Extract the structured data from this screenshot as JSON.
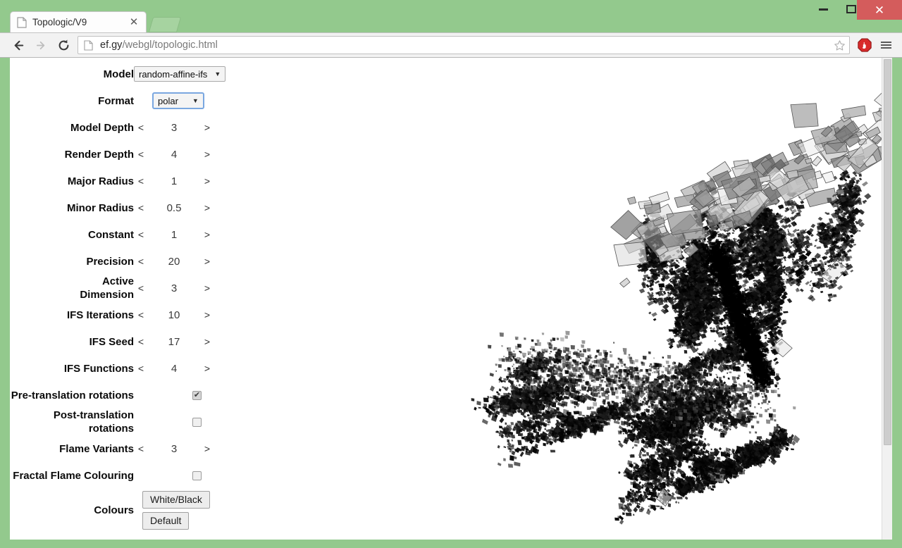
{
  "window": {
    "minimize_label": "–",
    "maximize_label": "□",
    "close_label": "✕"
  },
  "browser": {
    "tab": {
      "title": "Topologic/V9",
      "close_label": "✕",
      "favicon": "page-icon"
    },
    "new_tab_label": "",
    "toolbar": {
      "back_label": "←",
      "forward_label": "→",
      "reload_label": "⟳",
      "url_host": "ef.gy",
      "url_path": "/webgl/topologic.html",
      "url_full": "ef.gy/webgl/topologic.html",
      "bookmark_icon": "star-icon",
      "extension_icon": "adblock-icon",
      "menu_icon": "hamburger-icon"
    }
  },
  "settings": {
    "rows": [
      {
        "label": "Model",
        "type": "select",
        "value": "random-affine-ifs",
        "focused": false
      },
      {
        "label": "Format",
        "type": "select",
        "value": "polar",
        "focused": true
      },
      {
        "label": "Model Depth",
        "type": "stepper",
        "value": "3",
        "prev": "<",
        "next": ">"
      },
      {
        "label": "Render Depth",
        "type": "stepper",
        "value": "4",
        "prev": "<",
        "next": ">"
      },
      {
        "label": "Major Radius",
        "type": "stepper",
        "value": "1",
        "prev": "<",
        "next": ">"
      },
      {
        "label": "Minor Radius",
        "type": "stepper",
        "value": "0.5",
        "prev": "<",
        "next": ">"
      },
      {
        "label": "Constant",
        "type": "stepper",
        "value": "1",
        "prev": "<",
        "next": ">"
      },
      {
        "label": "Precision",
        "type": "stepper",
        "value": "20",
        "prev": "<",
        "next": ">"
      },
      {
        "label": "Active Dimension",
        "type": "stepper",
        "value": "3",
        "prev": "<",
        "next": ">"
      },
      {
        "label": "IFS Iterations",
        "type": "stepper",
        "value": "10",
        "prev": "<",
        "next": ">"
      },
      {
        "label": "IFS Seed",
        "type": "stepper",
        "value": "17",
        "prev": "<",
        "next": ">"
      },
      {
        "label": "IFS Functions",
        "type": "stepper",
        "value": "4",
        "prev": "<",
        "next": ">"
      },
      {
        "label": "Pre-translation rotations",
        "type": "checkbox",
        "checked": true,
        "tick": "✔"
      },
      {
        "label": "Post-translation rotations",
        "type": "checkbox",
        "checked": false,
        "tick": ""
      },
      {
        "label": "Flame Variants",
        "type": "stepper",
        "value": "3",
        "prev": "<",
        "next": ">"
      },
      {
        "label": "Fractal Flame Colouring",
        "type": "checkbox",
        "checked": false,
        "tick": ""
      },
      {
        "label": "Colours",
        "type": "buttons",
        "buttons": [
          "White/Black",
          "Default"
        ]
      }
    ]
  },
  "canvas": {
    "name": "webgl-fractal-render",
    "description": "random affine IFS attractor rendered as grayscale quads"
  },
  "colors": {
    "window_frame": "#93c98d",
    "close_button": "#d45c5c",
    "toolbar": "#f2f2f2",
    "focus_outline": "#7aa7e0",
    "page_background": "#ffffff",
    "fractal_ink": "#000000"
  }
}
